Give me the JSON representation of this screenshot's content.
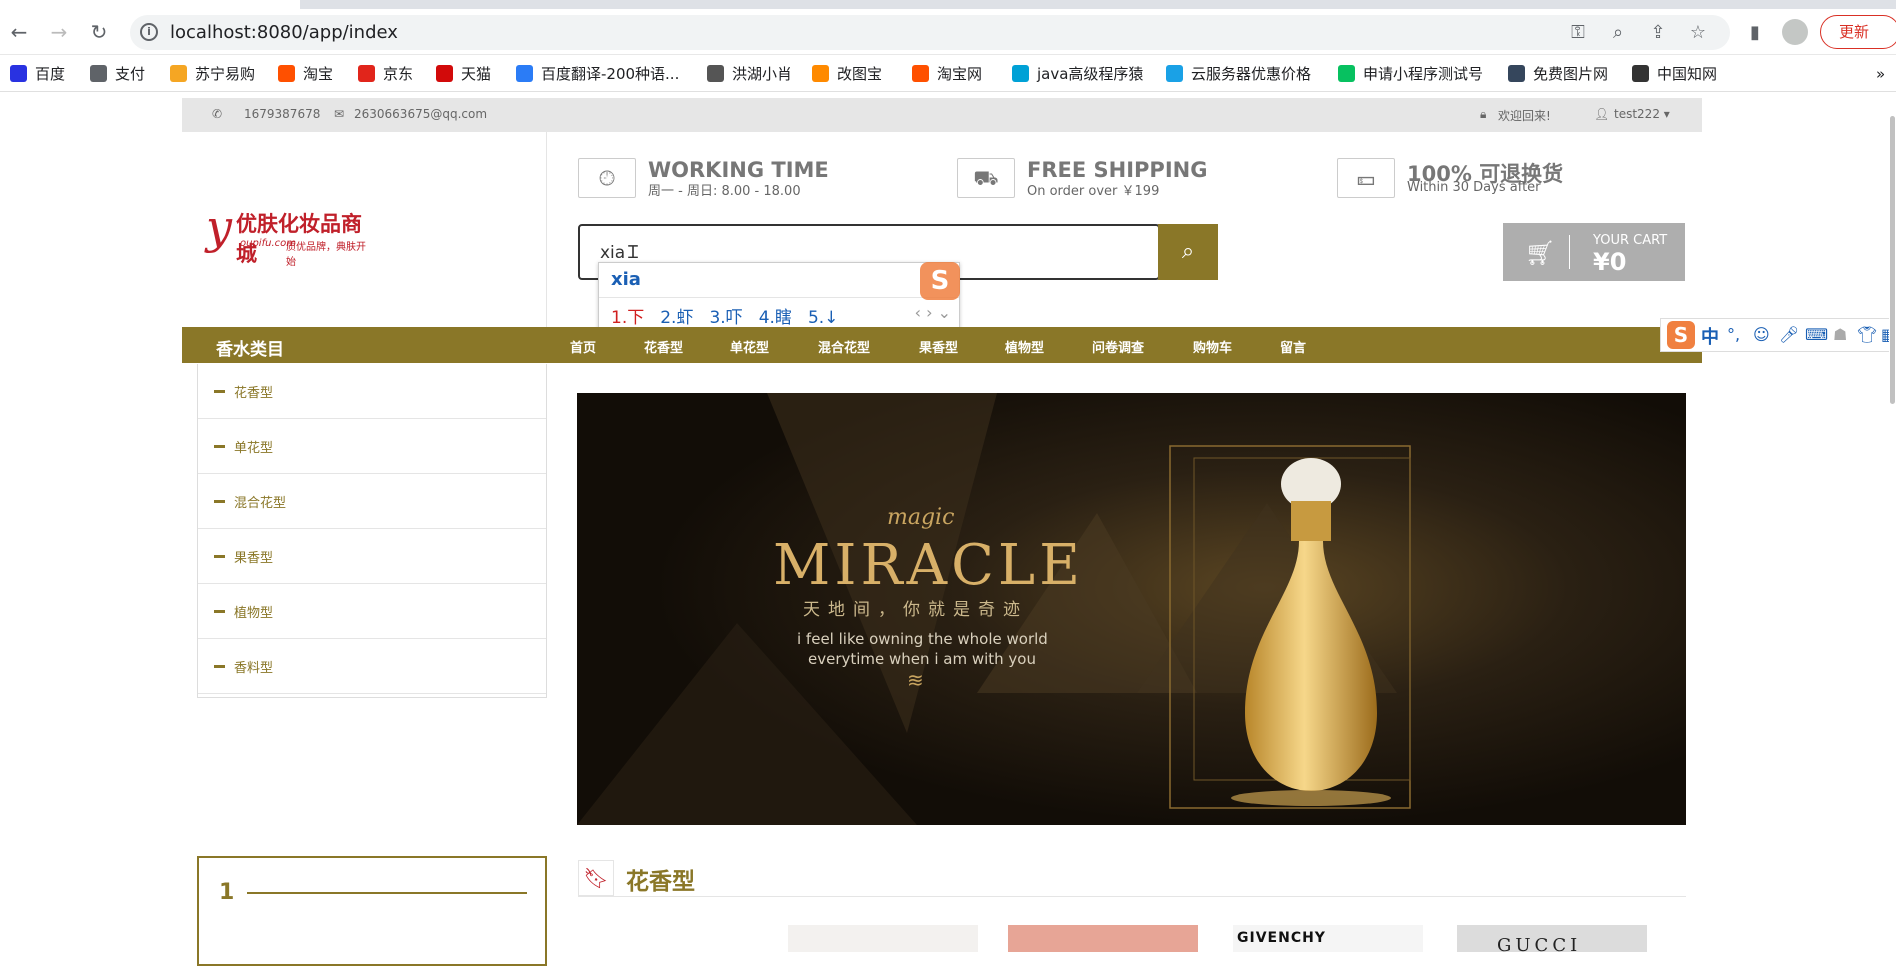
{
  "browser": {
    "url": "localhost:8080/app/index",
    "update_label": "更新",
    "bookmarks": [
      {
        "label": "百度",
        "icon": "baidu-icon",
        "color": "#2932e1"
      },
      {
        "label": "支付",
        "icon": "globe-icon",
        "color": "#5f6368"
      },
      {
        "label": "苏宁易购",
        "icon": "suning-icon",
        "color": "#f5a623"
      },
      {
        "label": "淘宝",
        "icon": "taobao-icon",
        "color": "#ff5000"
      },
      {
        "label": "京东",
        "icon": "jd-icon",
        "color": "#e1251b"
      },
      {
        "label": "天猫",
        "icon": "tmall-icon",
        "color": "#d20a0a"
      },
      {
        "label": "百度翻译-200种语...",
        "icon": "translate-icon",
        "color": "#2b7cf6"
      },
      {
        "label": "洪湖小肖",
        "icon": "feather-icon",
        "color": "#555555"
      },
      {
        "label": "改图宝",
        "icon": "gaitubao-icon",
        "color": "#ff8a00"
      },
      {
        "label": "淘宝网",
        "icon": "taobao-icon",
        "color": "#ff5000"
      },
      {
        "label": "java高级程序猿",
        "icon": "bilibili-icon",
        "color": "#00a1d6"
      },
      {
        "label": "云服务器优惠价格",
        "icon": "cloud-icon",
        "color": "#1aa1e6"
      },
      {
        "label": "申请小程序测试号",
        "icon": "wechat-icon",
        "color": "#07c160"
      },
      {
        "label": "免费图片网",
        "icon": "tumblr-icon",
        "color": "#35465c"
      },
      {
        "label": "中国知网",
        "icon": "cnki-icon",
        "color": "#333333"
      }
    ]
  },
  "topinfo": {
    "phone": "1679387678",
    "email": "2630663675@qq.com",
    "welcome": "欢迎回来!",
    "user": "test222"
  },
  "logo": {
    "main": "优肤化妆品商城",
    "sub": "oupifu.com",
    "tagline": "质优品牌，典肤开始"
  },
  "features": [
    {
      "title": "WORKING TIME",
      "sub": "周一 - 周日: 8.00 - 18.00",
      "icon": "clock-icon"
    },
    {
      "title": "FREE SHIPPING",
      "sub": "On order over ￥199",
      "icon": "truck-icon"
    },
    {
      "title": "100% 可退换货",
      "sub": "Within 30 Days after",
      "icon": "money-icon"
    }
  ],
  "search": {
    "value": "xia"
  },
  "cart": {
    "label": "YOUR CART",
    "value": "¥0"
  },
  "ime": {
    "pinyin": "xia",
    "candidates": [
      "1.下",
      "2.虾",
      "3.吓",
      "4.瞎",
      "5.↓"
    ],
    "toolbar_lang": "中"
  },
  "nav": {
    "category_title": "香水类目",
    "items": [
      "首页",
      "花香型",
      "单花型",
      "混合花型",
      "果香型",
      "植物型",
      "问卷调查",
      "购物车",
      "留言"
    ]
  },
  "sidebar": {
    "items": [
      "花香型",
      "单花型",
      "混合花型",
      "果香型",
      "植物型",
      "香料型"
    ]
  },
  "banner": {
    "small": "magic",
    "big": "MIRACLE",
    "cn": "天地间，你就是奇迹",
    "line1": "i feel like owning the whole world",
    "line2": "everytime when i am with you"
  },
  "bottom": {
    "box_number": "1",
    "section_title": "花香型",
    "brands": [
      "GIVENCHY",
      "GUCCI"
    ]
  }
}
